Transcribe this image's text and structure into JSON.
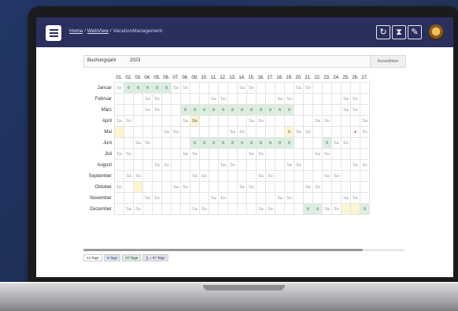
{
  "header": {
    "breadcrumb": [
      "Home",
      "WebView",
      "VacationManagement"
    ],
    "icons": [
      "refresh-icon",
      "hourglass-icon",
      "pencil-icon",
      "avatar"
    ]
  },
  "filter": {
    "label": "Buchungsjahr",
    "year": "2023",
    "button_label": "Auswählen"
  },
  "calendar": {
    "days": [
      "01.",
      "02.",
      "03.",
      "04.",
      "05.",
      "06.",
      "07.",
      "08.",
      "09.",
      "10.",
      "11.",
      "12.",
      "13.",
      "14.",
      "15.",
      "16.",
      "17.",
      "18.",
      "19.",
      "20.",
      "21.",
      "22.",
      "23.",
      "24.",
      "25.",
      "26.",
      "27."
    ],
    "months": [
      {
        "name": "Januar",
        "cells": [
          "So",
          "&",
          "&",
          "&",
          "&",
          "&",
          "Sa",
          "So",
          "",
          "",
          "",
          "",
          "",
          "Sa",
          "So",
          "",
          "",
          "",
          "",
          "Sa",
          "So",
          "",
          "",
          "",
          "",
          "",
          ""
        ]
      },
      {
        "name": "Februar",
        "cells": [
          "",
          "",
          "",
          "Sa",
          "So",
          "",
          "",
          "",
          "",
          "",
          "Sa",
          "So",
          "",
          "",
          "",
          "",
          "",
          "Sa",
          "So",
          "",
          "",
          "",
          "",
          "",
          "Sa",
          "So",
          ""
        ]
      },
      {
        "name": "März",
        "cells": [
          "",
          "",
          "",
          "Sa",
          "So",
          "",
          "",
          "&",
          "&",
          "&",
          "&",
          "&",
          "&",
          "&",
          "&",
          "&",
          "&",
          "&",
          "&",
          "",
          "",
          "",
          "",
          "",
          "Sa",
          "So",
          ""
        ]
      },
      {
        "name": "April",
        "cells": [
          "Sa",
          "So",
          "",
          "",
          "",
          "",
          "",
          "Sa",
          "So",
          "",
          "",
          "",
          "",
          "",
          "Sa",
          "So",
          "",
          "",
          "",
          "",
          "",
          "Sa",
          "So",
          "",
          "",
          "",
          "Sa"
        ]
      },
      {
        "name": "Mai",
        "cells": [
          "",
          "",
          "",
          "",
          "",
          "Sa",
          "So",
          "",
          "",
          "",
          "",
          "",
          "Sa",
          "So",
          "",
          "",
          "",
          "",
          "&",
          "Sa",
          "So",
          "",
          "",
          "",
          "",
          "pin",
          "So"
        ]
      },
      {
        "name": "Juni",
        "cells": [
          "",
          "",
          "Sa",
          "So",
          "",
          "",
          "",
          "",
          "&",
          "&",
          "&",
          "&",
          "&",
          "&",
          "&",
          "&",
          "&",
          "&",
          "&",
          "",
          "",
          "",
          "&",
          "Sa",
          "So",
          "",
          ""
        ]
      },
      {
        "name": "Juli",
        "cells": [
          "Sa",
          "So",
          "",
          "",
          "",
          "",
          "",
          "Sa",
          "So",
          "",
          "",
          "",
          "",
          "",
          "Sa",
          "So",
          "",
          "",
          "",
          "",
          "",
          "Sa",
          "So",
          "",
          "",
          "",
          ""
        ]
      },
      {
        "name": "August",
        "cells": [
          "",
          "",
          "",
          "",
          "Sa",
          "So",
          "",
          "",
          "",
          "",
          "",
          "Sa",
          "So",
          "",
          "",
          "",
          "",
          "",
          "Sa",
          "So",
          "",
          "",
          "",
          "",
          "",
          "Sa",
          "So"
        ]
      },
      {
        "name": "September",
        "cells": [
          "",
          "Sa",
          "So",
          "",
          "",
          "",
          "",
          "",
          "Sa",
          "So",
          "",
          "",
          "",
          "",
          "",
          "Sa",
          "So",
          "",
          "",
          "",
          "",
          "",
          "Sa",
          "So",
          "",
          "",
          ""
        ]
      },
      {
        "name": "Oktober",
        "cells": [
          "So",
          "",
          "",
          "",
          "",
          "",
          "Sa",
          "So",
          "",
          "",
          "",
          "",
          "",
          "Sa",
          "So",
          "",
          "",
          "",
          "",
          "",
          "Sa",
          "So",
          "",
          "",
          "",
          "",
          ""
        ]
      },
      {
        "name": "November",
        "cells": [
          "",
          "",
          "",
          "Sa",
          "So",
          "",
          "",
          "",
          "",
          "",
          "Sa",
          "So",
          "",
          "",
          "",
          "",
          "",
          "Sa",
          "So",
          "",
          "",
          "",
          "",
          "",
          "Sa",
          "So",
          ""
        ]
      },
      {
        "name": "Dezember",
        "cells": [
          "",
          "Sa",
          "So",
          "",
          "",
          "",
          "",
          "",
          "Sa",
          "So",
          "",
          "",
          "",
          "",
          "",
          "Sa",
          "So",
          "",
          "",
          "",
          "&",
          "&",
          "Sa",
          "So",
          "",
          "",
          "&"
        ]
      }
    ]
  },
  "legend": [
    "14 Tage",
    "6 Tage",
    "27 Tage",
    "∑ = 37 Tage"
  ],
  "colors": {
    "vacation": "#dbeee0",
    "holiday": "#fbf5d1",
    "topbar": "#2a2f5e"
  }
}
